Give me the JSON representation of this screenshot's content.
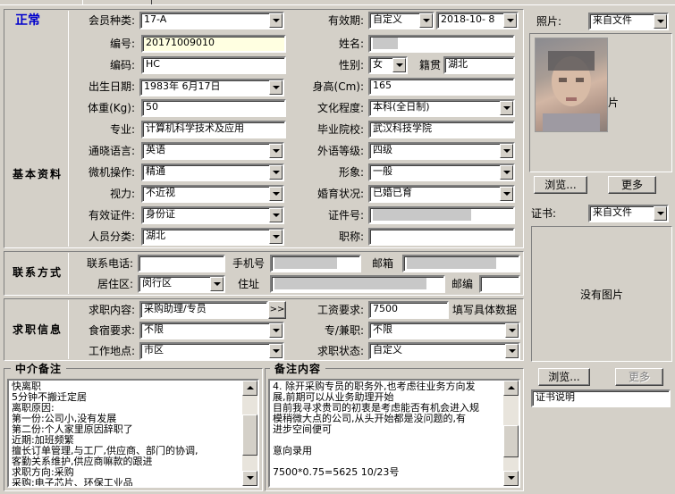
{
  "status": {
    "label": "正常"
  },
  "basic": {
    "section_title": "基本资料",
    "member_type": {
      "label": "会员种类:",
      "value": "17-A"
    },
    "validity": {
      "label": "有效期:",
      "mode": "自定义",
      "date": "2018-10- 8"
    },
    "number": {
      "label": "编号:",
      "value": "20171009010"
    },
    "name": {
      "label": "姓名:"
    },
    "code": {
      "label": "编码:",
      "value": "HC"
    },
    "gender": {
      "label": "性别:",
      "value": "女"
    },
    "native": {
      "label": "籍贯",
      "value": "湖北"
    },
    "birth": {
      "label": "出生日期:",
      "value": "1983年 6月17日"
    },
    "height": {
      "label": "身高(Cm):",
      "value": "165"
    },
    "weight": {
      "label": "体重(Kg):",
      "value": "50"
    },
    "education": {
      "label": "文化程度:",
      "value": "本科(全日制)"
    },
    "major": {
      "label": "专业:",
      "value": "计算机科学技术及应用"
    },
    "school": {
      "label": "毕业院校:",
      "value": "武汉科技学院"
    },
    "language": {
      "label": "通晓语言:",
      "value": "英语"
    },
    "foreign_level": {
      "label": "外语等级:",
      "value": "四级"
    },
    "computer": {
      "label": "微机操作:",
      "value": "精通"
    },
    "image": {
      "label": "形象:",
      "value": "一般"
    },
    "vision": {
      "label": "视力:",
      "value": "不近视"
    },
    "marital": {
      "label": "婚育状况:",
      "value": "已婚已育"
    },
    "id_type": {
      "label": "有效证件:",
      "value": "身份证"
    },
    "id_number": {
      "label": "证件号:"
    },
    "category": {
      "label": "人员分类:",
      "value": "湖北"
    },
    "title": {
      "label": "职称:",
      "value": ""
    }
  },
  "contact": {
    "section_title": "联系方式",
    "phone": {
      "label": "联系电话:",
      "value": ""
    },
    "mobile": {
      "label": "手机号"
    },
    "email": {
      "label": "邮箱"
    },
    "district": {
      "label": "居住区:",
      "value": "闵行区"
    },
    "address": {
      "label": "住址"
    },
    "postcode": {
      "label": "邮编",
      "value": ""
    }
  },
  "job": {
    "section_title": "求职信息",
    "content": {
      "label": "求职内容:",
      "value": "采购助理/专员",
      "more": ">>"
    },
    "salary": {
      "label": "工资要求:",
      "value": "7500",
      "note": "填写具体数据"
    },
    "lodging": {
      "label": "食宿要求:",
      "value": "不限"
    },
    "parttime": {
      "label": "专/兼职:",
      "value": "不限"
    },
    "location": {
      "label": "工作地点:",
      "value": "市区"
    },
    "state": {
      "label": "求职状态:",
      "value": "自定义"
    }
  },
  "agency_note": {
    "title": "中介备注",
    "lines": [
      "快离职",
      "5分钟不搬迁定居",
      "离职原因:",
      "第一份:公司小,没有发展",
      "第二份:个人家里原因辞职了",
      "近期:加班频繁",
      "擅长订单管理,与工厂,供应商、部门的协调,",
      "客勤关系维护,供应商嘛款的跟进",
      "求职方向:采购",
      "采购:电子芯片、环保工业品"
    ]
  },
  "remark": {
    "title": "备注内容",
    "lines": [
      "4. 除开采购专员的职务外,也考虑往业务方向发",
      "展,前期可以从业务助理开始",
      "目前我寻求贵司的初衷是考虑能否有机会进入规",
      "模稍微大点的公司,从头开始都是没问题的,有",
      "进步空间便可",
      "",
      "意向录用",
      "",
      "7500*0.75=5625     10/23号"
    ]
  },
  "photo": {
    "label": "照片:",
    "source": "来自文件",
    "side_text": "片",
    "browse": "浏览...",
    "more": "更多"
  },
  "cert": {
    "label": "证书:",
    "source": "来自文件",
    "empty": "没有图片",
    "browse": "浏览...",
    "more": "更多",
    "desc": "证书说明"
  }
}
